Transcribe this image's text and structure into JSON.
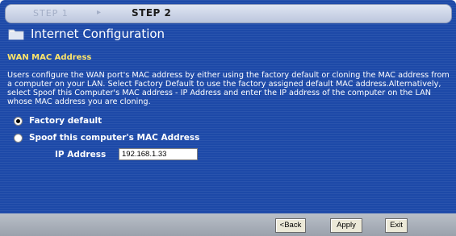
{
  "steps": {
    "step1_label": "STEP 1",
    "step2_label": "STEP 2"
  },
  "page": {
    "title": "Internet Configuration",
    "title_icon": "folder-icon"
  },
  "section": {
    "title": "WAN MAC Address",
    "description": "Users configure the WAN port's MAC address by either using the factory default or cloning the MAC address from a computer on your LAN. Select Factory Default to use the factory assigned default MAC address.Alternatively, select Spoof this Computer's MAC address - IP Address and enter the IP address of the computer on the LAN whose MAC address you are cloning."
  },
  "options": {
    "factory_default_label": "Factory default",
    "factory_default_selected": true,
    "spoof_label": "Spoof this computer's MAC Address",
    "spoof_selected": false
  },
  "ip": {
    "label": "IP Address",
    "value": "192.168.1.33"
  },
  "buttons": {
    "back": "<Back",
    "apply": "Apply",
    "exit": "Exit"
  },
  "colors": {
    "panel_bg": "#1d49a8",
    "section_title": "#ffe66a",
    "text": "#ffffff"
  }
}
